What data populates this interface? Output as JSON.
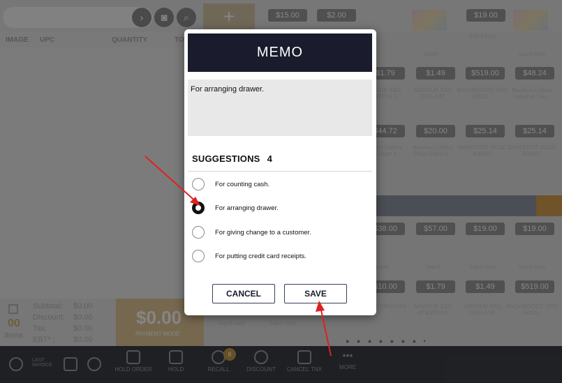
{
  "background": {
    "search_placeholder": "",
    "columns": [
      "IMAGE",
      "UPC",
      "QUANTITY",
      "TO"
    ],
    "price_tiles_row1": [
      "$15.00",
      "$2.00",
      "$19.00"
    ],
    "tile_row1_labels": [
      "1april copy",
      "1april"
    ],
    "price_tiles_row2": [
      "$1.79",
      "$1.49",
      "$519.00",
      "$48.24"
    ],
    "tile_row2_labels": [
      "ARMOUR SSG HT&SPY4.6",
      "ARMOUR SSG ORG 4.6Z",
      "BACKWOODS ORG (WILD...",
      "Barefoot Cellars Cabernet Sau..."
    ],
    "price_tiles_row3": [
      "$44.72",
      "$20.00",
      "$25.14",
      "$25.14"
    ],
    "tile_row3_labels": [
      "Barefoot Cellars Pinot Grigio 1...",
      "Barefoot Cellars Pinot Grigio 6...",
      "BAREFOOT ROSE 6/4/187",
      "BAREFOOT ROSE 6/4/187"
    ],
    "price_tiles_row4": [
      "$38.00",
      "$57.00",
      "$19.00",
      "$19.00"
    ],
    "tile_row4_labels": [
      "1april",
      "1april",
      "1april copy",
      "1april copy"
    ],
    "price_tiles_row5": [
      "$10.00",
      "$1.79",
      "$1.49",
      "$519.00"
    ],
    "tile_row5_labels": [
      "SPIRIT1 ORDXXXX",
      "ARMOUR SSG HT&SPY4.6",
      "ARMOUR SSG ORG 4.6Z",
      "BACKWOODS ORG (WILD..."
    ],
    "bottom_tile_labels": [
      "1april copy",
      "1april copy"
    ],
    "totals": {
      "items_count": "00",
      "items_label": "Items",
      "subtotal_label": "Subtotal:",
      "subtotal_value": "$0.00",
      "discount_label": "Discount:",
      "discount_value": "$0.00",
      "tax_label": "Tax:",
      "tax_value": "$0.00",
      "ebt_label": "EBT* :",
      "ebt_value": "$0.00"
    },
    "pay_amount": "$0.00",
    "pay_label": "PAYMENT MODE",
    "bottom_bar": {
      "last_invoice": "LAST INVOICE",
      "hold_order": "HOLD ORDER",
      "hold": "HOLD",
      "recall": "RECALL",
      "recall_badge": "8",
      "discount": "DISCOUNT",
      "cancel_tnx": "CANCEL TNX",
      "more": "MORE"
    }
  },
  "modal": {
    "title": "MEMO",
    "memo_text": "For arranging drawer.",
    "suggestions_label": "SUGGESTIONS",
    "suggestions_count": "4",
    "suggestions": [
      {
        "text": "For counting cash.",
        "selected": false
      },
      {
        "text": "For arranging drawer.",
        "selected": true
      },
      {
        "text": "For giving change to a customer.",
        "selected": false
      },
      {
        "text": "For putting credit card receipts.",
        "selected": false
      }
    ],
    "cancel_label": "CANCEL",
    "save_label": "SAVE"
  },
  "colors": {
    "modal_header": "#1a1b2c",
    "annotation_arrow": "#e02020",
    "button_border": "#3a3f58"
  }
}
